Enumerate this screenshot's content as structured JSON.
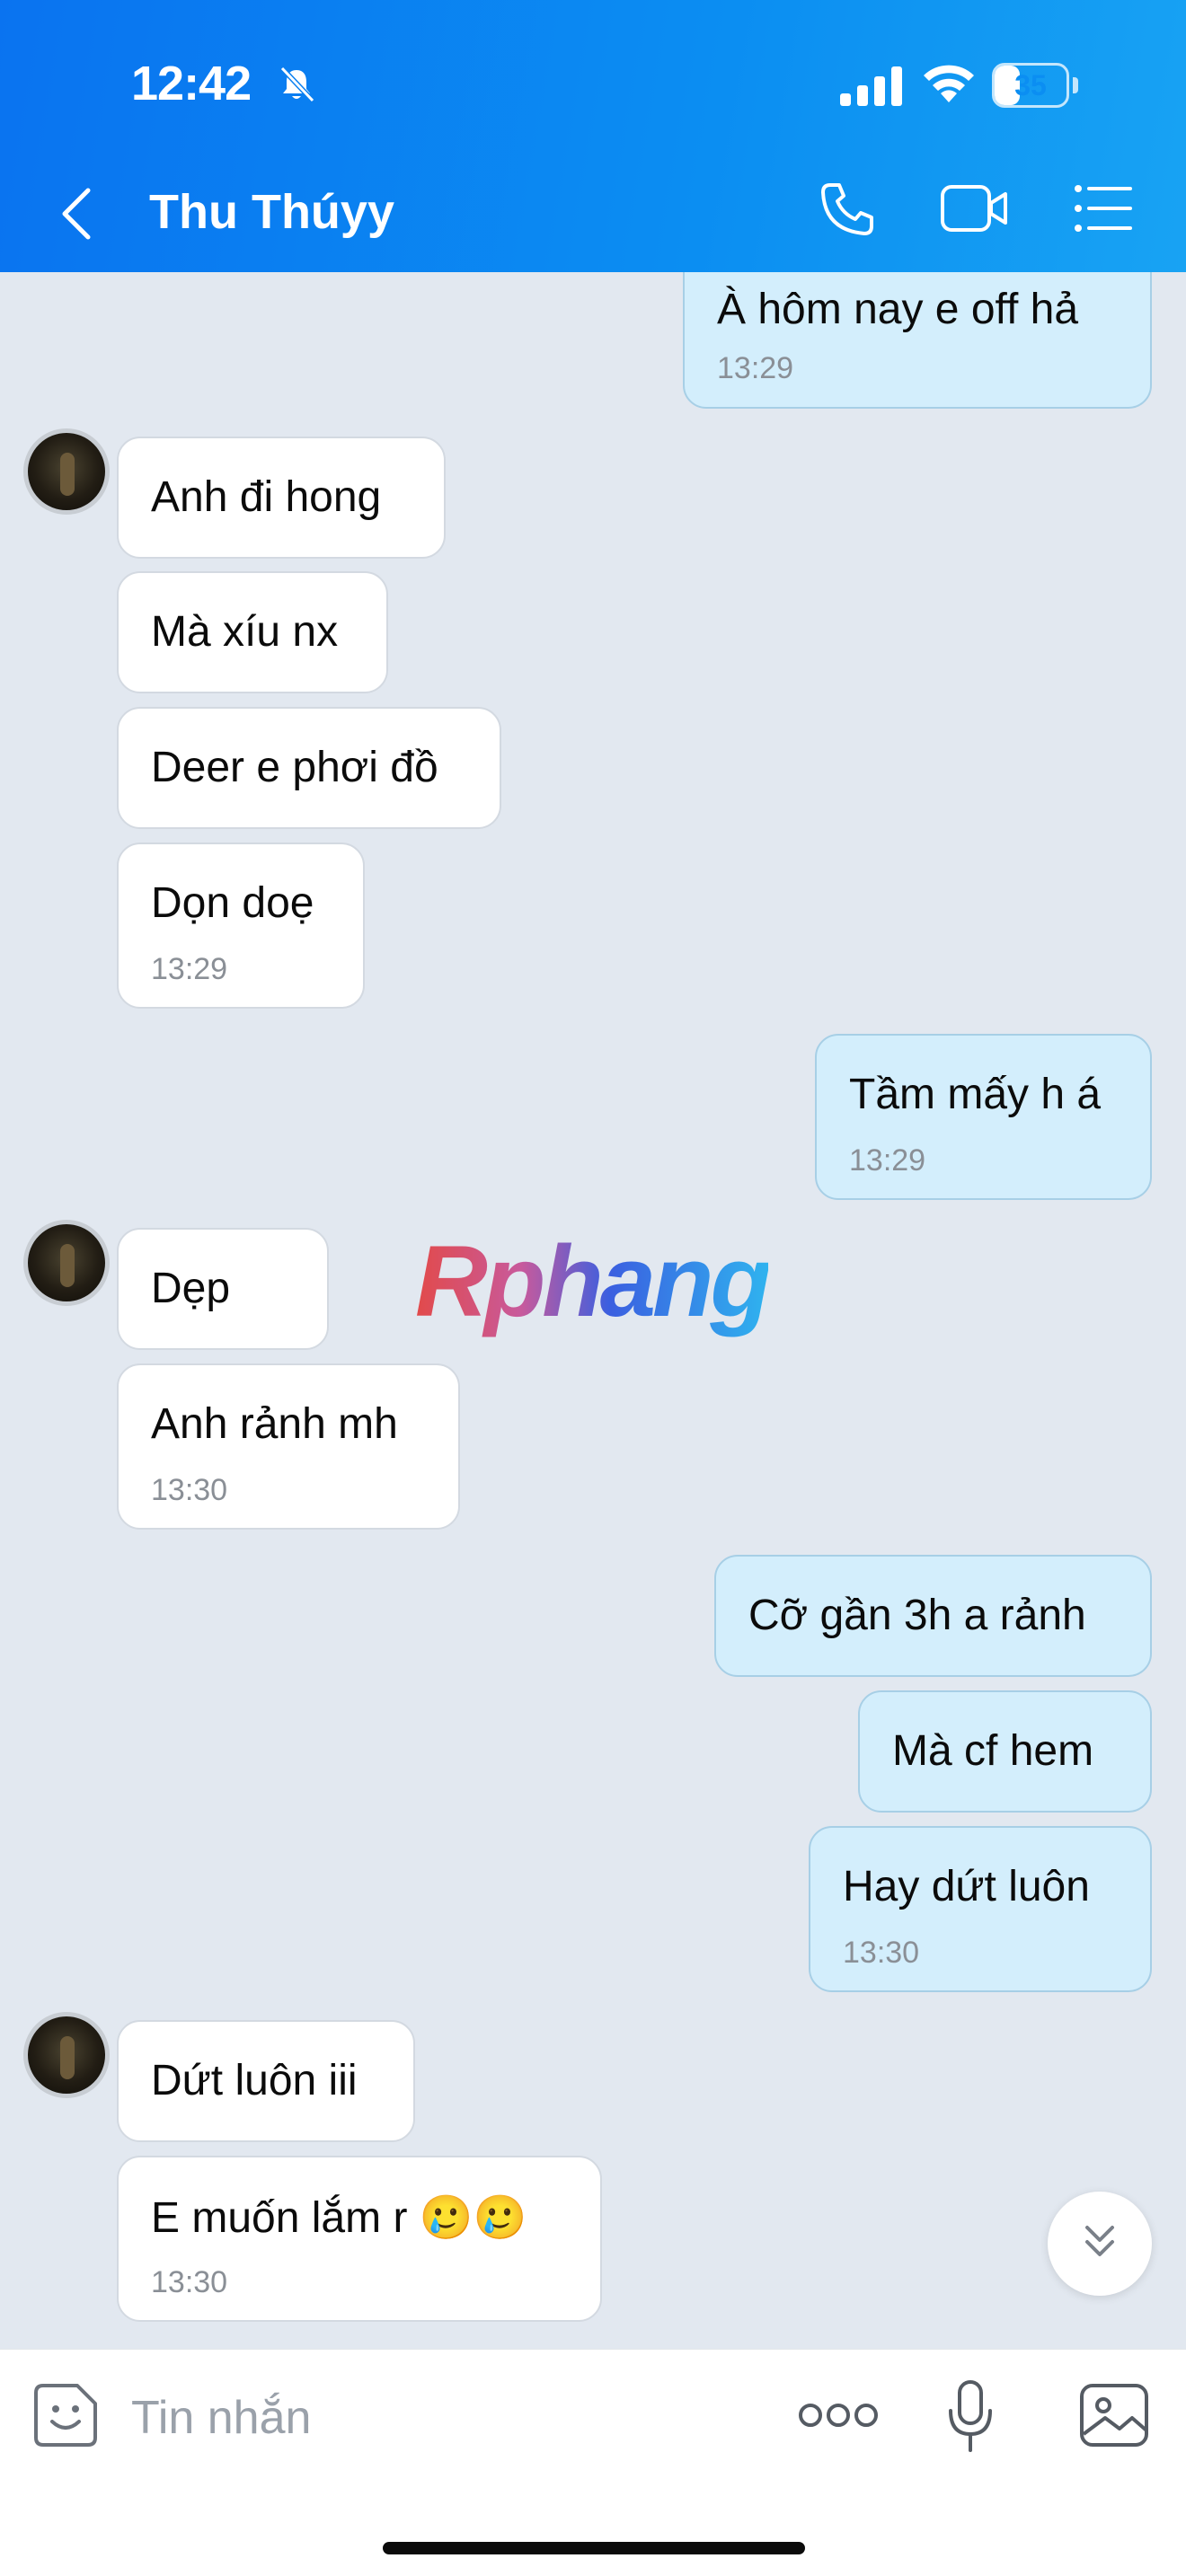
{
  "status_bar": {
    "time": "12:42",
    "battery": "35",
    "battery_level": 0.35
  },
  "header": {
    "contact_name": "Thu Thúyy"
  },
  "messages": [
    {
      "dir": "out",
      "text": "À hôm nay e off hả",
      "time": "13:29"
    },
    {
      "dir": "in",
      "text": "Anh đi hong"
    },
    {
      "dir": "in",
      "text": "Mà xíu nx"
    },
    {
      "dir": "in",
      "text": "Deer e phơi đồ"
    },
    {
      "dir": "in",
      "text": "Dọn doẹ",
      "time": "13:29"
    },
    {
      "dir": "out",
      "text": "Tầm mấy h á",
      "time": "13:29"
    },
    {
      "dir": "in",
      "text": "Dẹp"
    },
    {
      "dir": "in",
      "text": "Anh rảnh mh",
      "time": "13:30"
    },
    {
      "dir": "out",
      "text": "Cỡ gần 3h a rảnh"
    },
    {
      "dir": "out",
      "text": "Mà cf hem"
    },
    {
      "dir": "out",
      "text": "Hay dứt luôn",
      "time": "13:30"
    },
    {
      "dir": "in",
      "text": "Dứt luôn iii"
    },
    {
      "dir": "in",
      "text": "E muốn lắm r 🥲🥲",
      "time": "13:30"
    }
  ],
  "watermark": "Rphang",
  "composer": {
    "placeholder": "Tin nhắn"
  },
  "colors": {
    "header": "#0b8ef2",
    "bubble_out": "#d3eefc",
    "bubble_in": "#ffffff",
    "background": "#e2e8f0"
  },
  "icons": [
    "bell-muted-icon",
    "signal-icon",
    "wifi-icon",
    "battery-icon",
    "back-chevron-icon",
    "phone-icon",
    "video-icon",
    "list-menu-icon",
    "scroll-down-icon",
    "sticker-icon",
    "more-icon",
    "microphone-icon",
    "image-icon"
  ]
}
